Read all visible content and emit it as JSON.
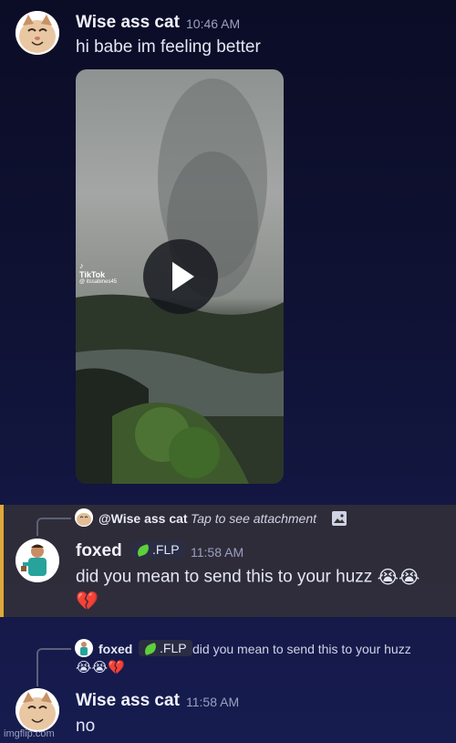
{
  "message1": {
    "username": "Wise ass cat",
    "time": "10:46 AM",
    "text": "hi babe im feeling better",
    "video_watermark": "TikTok",
    "video_handle": "@ itssabines45"
  },
  "message2": {
    "reply_to_name": "@Wise ass cat",
    "reply_preview": "Tap to see attachment",
    "username": "foxed",
    "tag": ".FLP",
    "time": "11:58 AM",
    "text": "did you mean to send this to your huzz",
    "emojis": "😭😭",
    "broken_heart": "💔"
  },
  "message3": {
    "reply_to_name": "foxed",
    "reply_tag": ".FLP",
    "reply_preview": "did you mean to send this to your huzz",
    "reply_emojis": "😭😭💔",
    "username": "Wise ass cat",
    "time": "11:58 AM",
    "text": "no"
  },
  "watermark": "imgflip.com"
}
